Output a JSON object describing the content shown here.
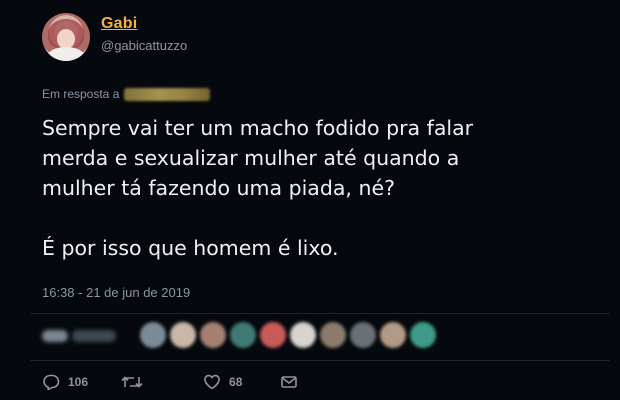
{
  "tweet": {
    "display_name": "Gabi",
    "handle": "@gabicattuzzo",
    "reply_prefix": "Em resposta a",
    "text_lines": [
      "Sempre vai ter um macho fodido pra falar",
      "merda e sexualizar mulher até quando a",
      "mulher tá fazendo uma piada, né?"
    ],
    "text_paragraph2": "É por isso que homem é lixo.",
    "timestamp": "16:38 - 21 de jun de 2019"
  },
  "actions": {
    "replies": "106",
    "likes": "68"
  },
  "colors": {
    "background": "#05090e",
    "name": "#f2b24a",
    "secondary_text": "#8a96a3",
    "primary_text": "#eef1f4"
  },
  "icons": [
    "reply-icon",
    "retweet-icon",
    "heart-icon",
    "message-icon"
  ]
}
